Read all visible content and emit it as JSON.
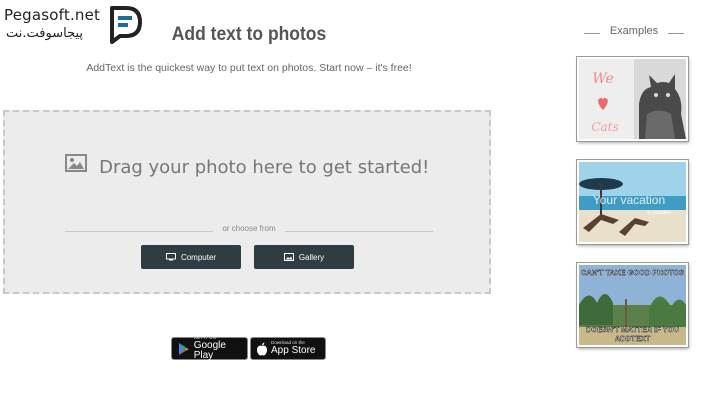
{
  "watermark": {
    "text_en": "Pegasoft.net",
    "text_fa": "پیجاسوفت.نت"
  },
  "header": {
    "title": "Add text to photos",
    "subtitle": "AddText is the quickest way to put text on photos. Start now – it's free!"
  },
  "dropzone": {
    "icon": "image-icon",
    "drag_text": "Drag your photo here to get started!",
    "choose_text": "or choose from",
    "buttons": [
      {
        "label": "Computer",
        "icon": "monitor-icon"
      },
      {
        "label": "Gallery",
        "icon": "image-icon"
      }
    ]
  },
  "stores": {
    "google": {
      "small": "GET IT ON",
      "big": "Google Play"
    },
    "apple": {
      "small": "Download on the",
      "big": "App Store"
    }
  },
  "examples": {
    "label": "Examples",
    "items": [
      {
        "caption_line1": "We",
        "caption_line2": "Cats"
      },
      {
        "caption_line1": "Your vacation",
        "caption_line2": "in paradise"
      },
      {
        "caption_line1": "CAN'T TAKE GOOD PHOTOS",
        "caption_line2": "DOESN'T MATTER IF YOU",
        "caption_line3": "ADDTEXT"
      }
    ]
  },
  "colors": {
    "button_bg": "#2f3c42",
    "dropzone_bg": "#ececec",
    "logo_accent": "#1e6a9a"
  }
}
